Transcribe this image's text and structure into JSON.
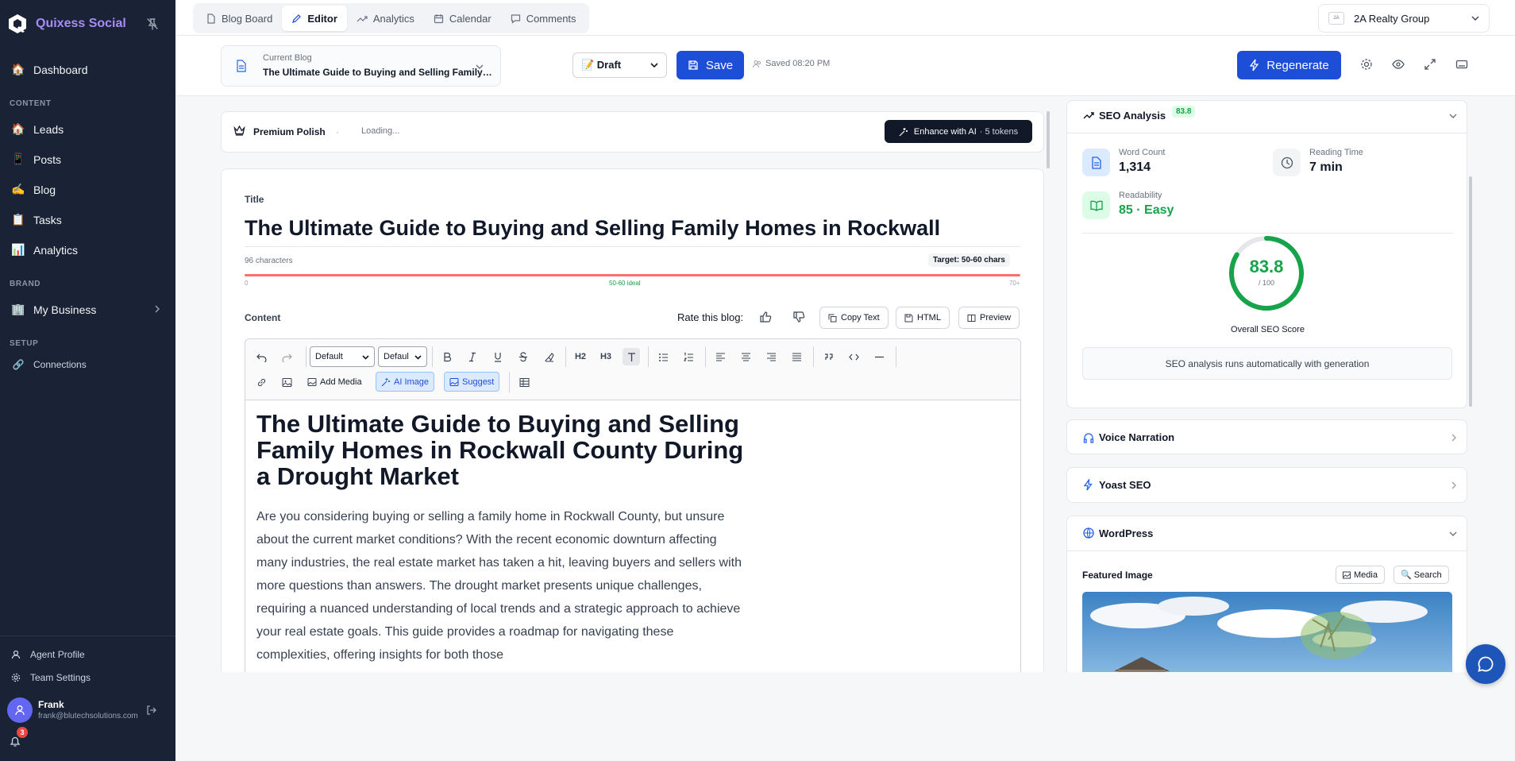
{
  "sidebar": {
    "brand": "Quixess Social",
    "dashboard": "Dashboard",
    "section_content": "CONTENT",
    "items": [
      {
        "label": "Leads",
        "icon": "🏠"
      },
      {
        "label": "Posts",
        "icon": "📱"
      },
      {
        "label": "Blog",
        "icon": "✍️"
      },
      {
        "label": "Tasks",
        "icon": "📋"
      },
      {
        "label": "Analytics",
        "icon": "📊"
      }
    ],
    "dashboard_icon": "🏠",
    "section_brand": "BRAND",
    "my_business": "My Business",
    "my_business_icon": "🏢",
    "section_setup": "SETUP",
    "connections": "Connections",
    "agent_profile": "Agent Profile",
    "team_settings": "Team Settings",
    "user": {
      "name": "Frank",
      "email": "frank@blutechsolutions.com"
    },
    "notification_count": "3"
  },
  "topbar": {
    "tabs": [
      "Blog Board",
      "Editor",
      "Analytics",
      "Calendar",
      "Comments"
    ],
    "active_tab": "Editor",
    "org_logo_text": "2A",
    "org_name": "2A Realty Group"
  },
  "header": {
    "current_blog_label": "Current Blog",
    "current_blog_title": "The Ultimate Guide to Buying and Selling Family Homes in Rockwall County During a Drought Market",
    "status": "📝 Draft",
    "save_label": "Save",
    "saved_text": "Saved 08:20 PM",
    "regenerate_label": "Regenerate"
  },
  "premium": {
    "title": "Premium Polish",
    "separator": "·",
    "status": "Loading...",
    "enhance_label": "Enhance with AI",
    "tokens": "· 5 tokens"
  },
  "editor": {
    "title_label": "Title",
    "title_value": "The Ultimate Guide to Buying and Selling Family Homes in Rockwall",
    "char_count": "96 characters",
    "target": "Target: 50-60 chars",
    "range_min": "0",
    "range_ideal": "50-60 ideal",
    "range_max": "70+",
    "content_label": "Content",
    "rate_label": "Rate this blog:",
    "copy_text": "Copy Text",
    "html": "HTML",
    "preview": "Preview",
    "toolbar": {
      "style_select": "Default",
      "font_select": "Defaul",
      "h2": "H2",
      "h3": "H3",
      "add_media": "Add Media",
      "ai_image": "AI Image",
      "suggest": "Suggest"
    },
    "heading": "The Ultimate Guide to Buying and Selling Family Homes in Rockwall County During a Drought Market",
    "paragraph": "Are you considering buying or selling a family home in Rockwall County, but unsure about the current market conditions? With the recent economic downturn affecting many industries, the real estate market has taken a hit, leaving buyers and sellers with more questions than answers. The drought market presents unique challenges, requiring a nuanced understanding of local trends and a strategic approach to achieve your real estate goals. This guide provides a roadmap for navigating these complexities, offering insights for both those"
  },
  "seo": {
    "title": "SEO Analysis",
    "score_badge": "83.8",
    "word_count_label": "Word Count",
    "word_count": "1,314",
    "reading_time_label": "Reading Time",
    "reading_time": "7 min",
    "readability_label": "Readability",
    "readability": "85 · Easy",
    "score": "83.8",
    "score_max": "/ 100",
    "score_fraction": 0.838,
    "overall_label": "Overall SEO Score",
    "auto_note": "SEO analysis runs automatically with generation"
  },
  "panels": {
    "voice": "Voice Narration",
    "yoast": "Yoast SEO",
    "wordpress": "WordPress",
    "featured_image": "Featured Image",
    "media_btn": "Media",
    "search_btn": "🔍 Search"
  },
  "colors": {
    "accent": "#1d4ed8",
    "sidebar": "#1a2335",
    "success": "#16a34a",
    "brand": "#a78bfa"
  }
}
